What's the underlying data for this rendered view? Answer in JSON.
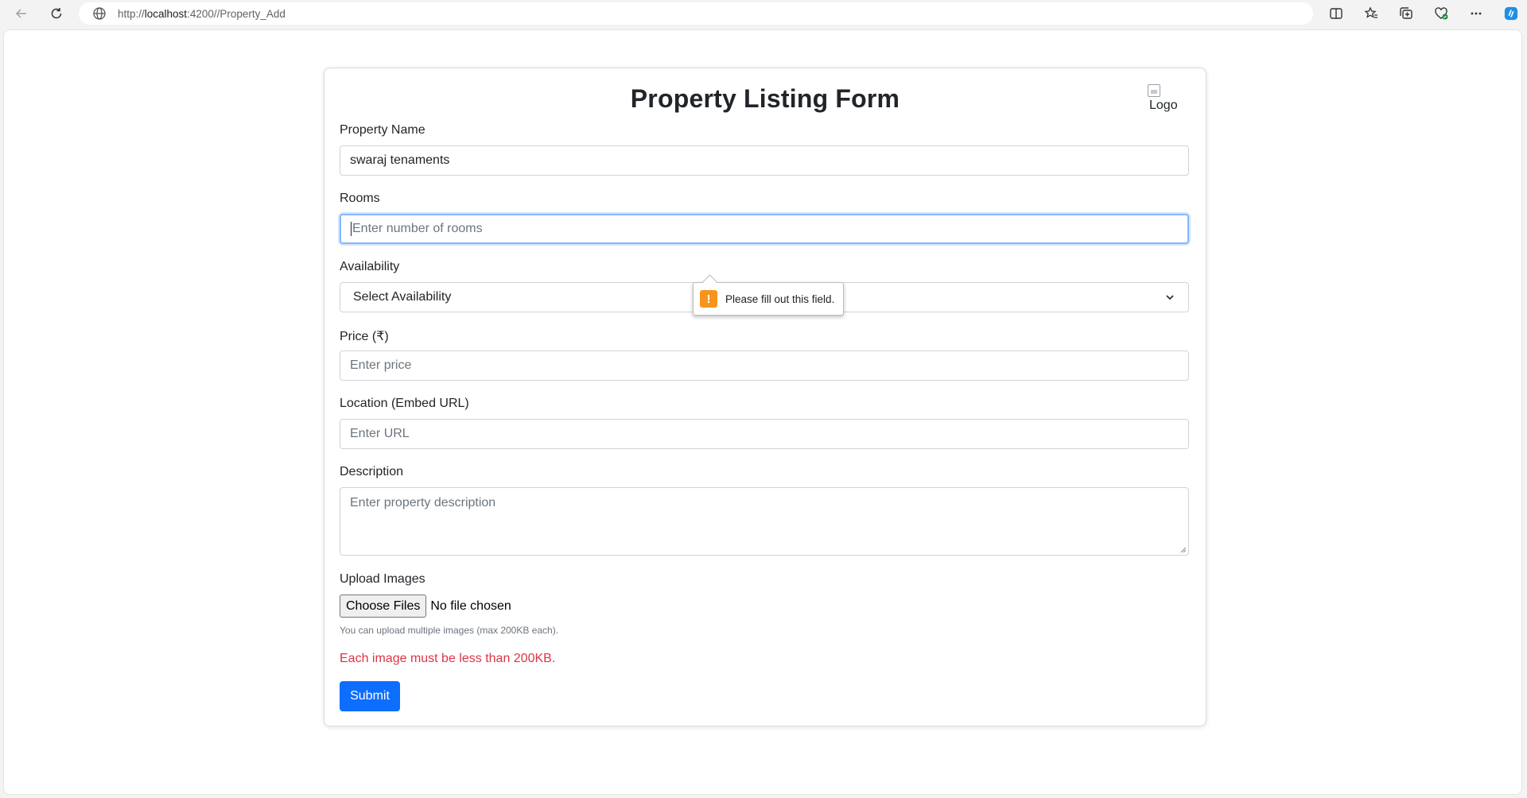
{
  "browser": {
    "url_prefix": "http://",
    "url_host": "localhost",
    "url_rest": ":4200//Property_Add"
  },
  "form": {
    "title": "Property Listing Form",
    "logo_alt": "Logo",
    "property_name": {
      "label": "Property Name",
      "value": "swaraj tenaments"
    },
    "rooms": {
      "label": "Rooms",
      "placeholder": "Enter number of rooms"
    },
    "availability": {
      "label": "Availability",
      "selected": "Select Availability"
    },
    "price": {
      "label": "Price (₹)",
      "placeholder": "Enter price"
    },
    "location": {
      "label": "Location (Embed URL)",
      "placeholder": "Enter URL"
    },
    "description": {
      "label": "Description",
      "placeholder": "Enter property description"
    },
    "upload": {
      "label": "Upload Images",
      "button": "Choose Files",
      "status": "No file chosen",
      "hint": "You can upload multiple images (max 200KB each)."
    },
    "error": "Each image must be less than 200KB.",
    "submit": "Submit"
  },
  "tooltip": {
    "message": "Please fill out this field.",
    "icon": "!"
  },
  "colors": {
    "primary": "#0d6efd",
    "error": "#dc3545",
    "warning": "#f7941d",
    "focus": "#86b7fe"
  }
}
